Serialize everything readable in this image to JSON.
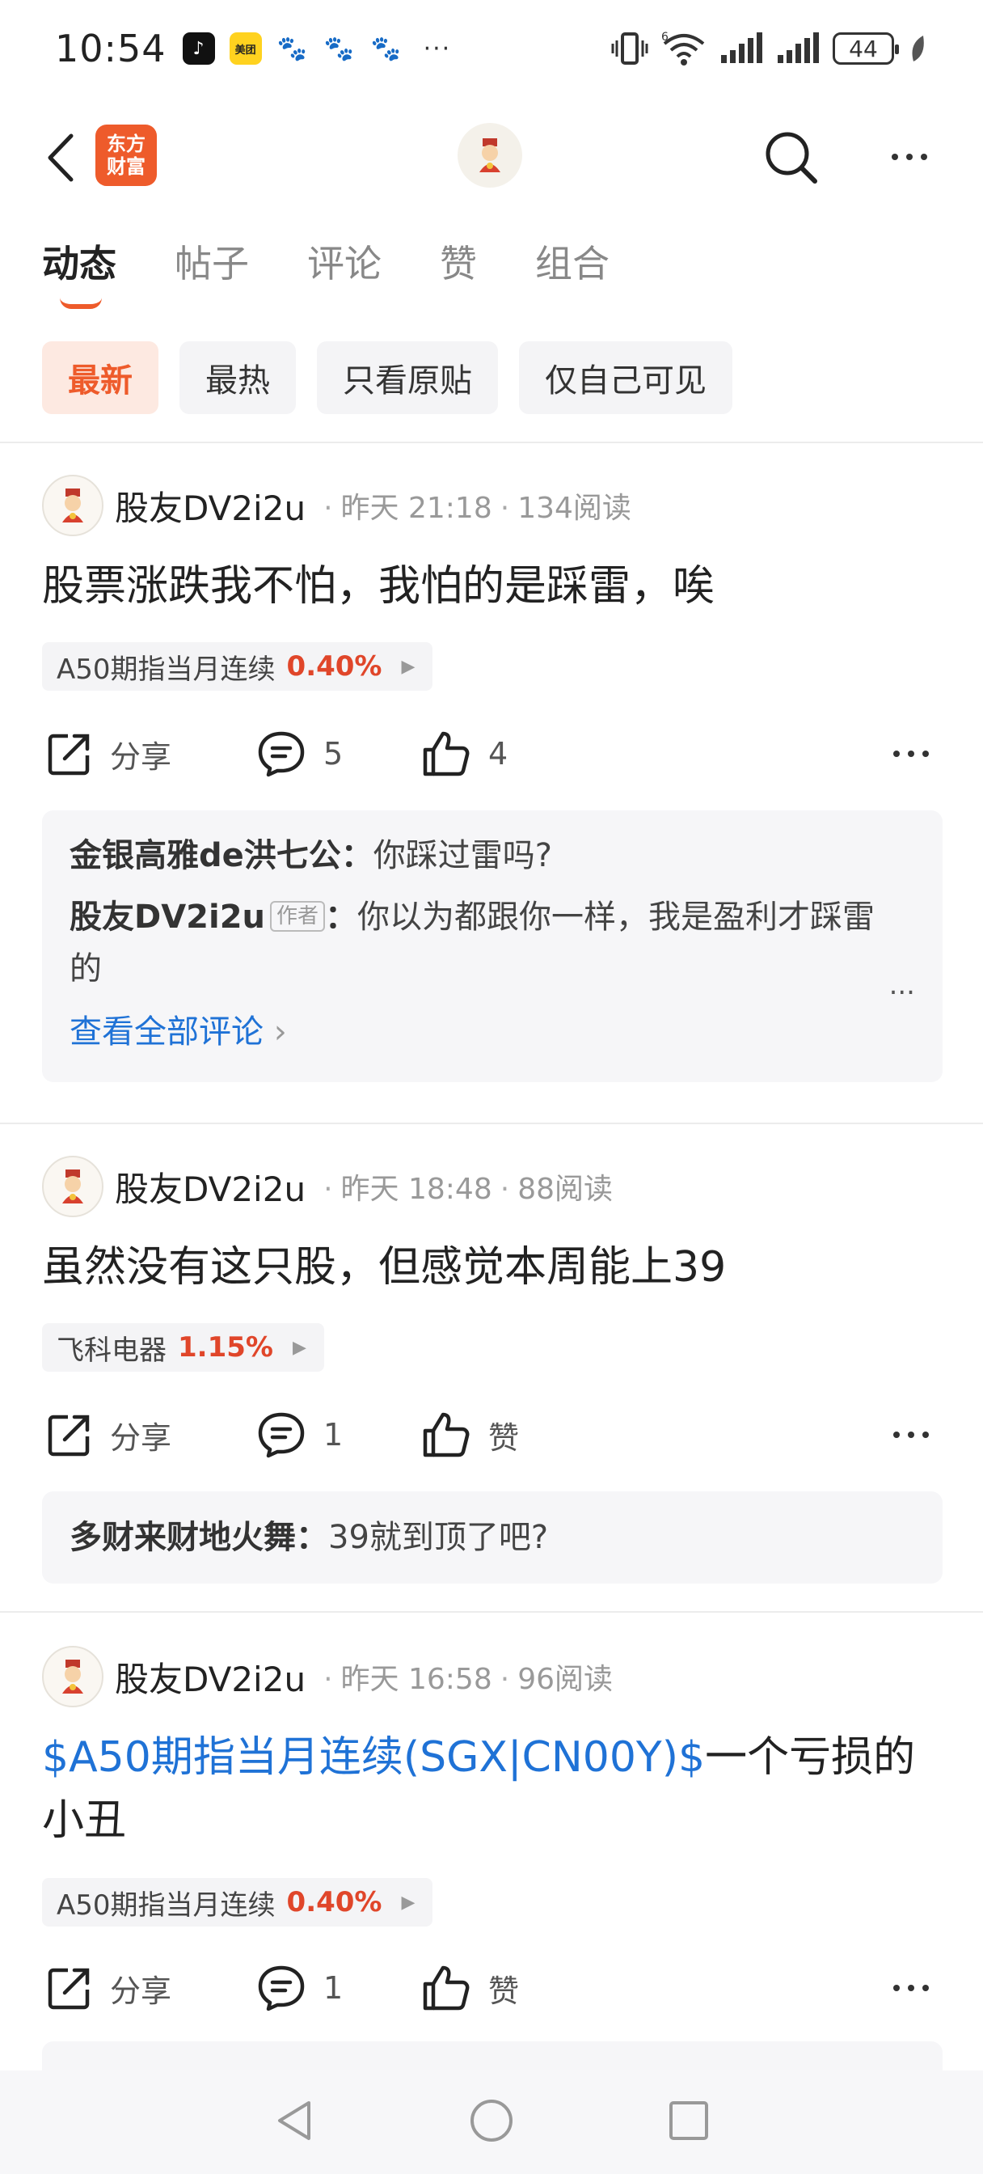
{
  "status_bar": {
    "time": "10:54",
    "apps": [
      "tiktok-icon",
      "meituan-icon",
      "baidu-icon",
      "baidu-icon",
      "baidu-icon"
    ],
    "meituan_label": "美团",
    "more": "···",
    "battery": "44",
    "network": "6"
  },
  "header": {
    "brand_line1": "东方",
    "brand_line2": "财富"
  },
  "tabs": [
    "动态",
    "帖子",
    "评论",
    "赞",
    "组合"
  ],
  "filters": [
    "最新",
    "最热",
    "只看原贴",
    "仅自己可见"
  ],
  "posts": [
    {
      "author": "股友DV2i2u",
      "time": "昨天 21:18",
      "reads": "134阅读",
      "text": "股票涨跌我不怕，我怕的是踩雷，唉",
      "stock_name": "A50期指当月连续",
      "stock_pct": "0.40%",
      "share": "分享",
      "comments": "5",
      "likes": "4",
      "comment_list": [
        {
          "user": "金银高雅de洪七公",
          "sep": "：",
          "text": "你踩过雷吗?"
        },
        {
          "user": "股友DV2i2u",
          "tag": "作者",
          "sep": "：",
          "text": "你以为都跟你一样，我是盈利才踩雷的"
        }
      ],
      "ellipsis": "...",
      "view_all": "查看全部评论",
      "view_all_arrow": "›"
    },
    {
      "author": "股友DV2i2u",
      "time": "昨天 18:48",
      "reads": "88阅读",
      "text": "虽然没有这只股，但感觉本周能上39",
      "stock_name": "飞科电器",
      "stock_pct": "1.15%",
      "share": "分享",
      "comments": "1",
      "likes": "赞",
      "comment_list": [
        {
          "user": "多财来财地火舞",
          "sep": "：",
          "text": "39就到顶了吧?"
        }
      ]
    },
    {
      "author": "股友DV2i2u",
      "time": "昨天 16:58",
      "reads": "96阅读",
      "text_link": "$A50期指当月连续(SGX|CN00Y)$",
      "text": "一个亏损的小丑",
      "stock_name": "A50期指当月连续",
      "stock_pct": "0.40%",
      "share": "分享",
      "comments": "1",
      "likes": "赞"
    }
  ],
  "colors": {
    "accent": "#ee5b2b",
    "link": "#1f72d6",
    "up": "#e0462a"
  }
}
